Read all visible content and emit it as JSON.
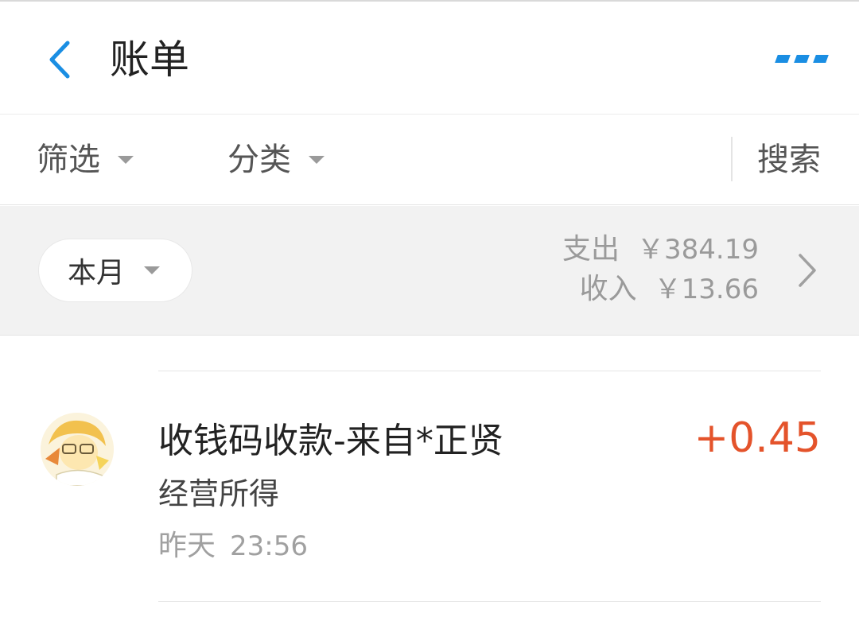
{
  "header": {
    "title": "账单"
  },
  "filters": {
    "filter_label": "筛选",
    "category_label": "分类",
    "search_label": "搜索"
  },
  "summary": {
    "period_label": "本月",
    "expense_label": "支出",
    "expense_amount": "￥384.19",
    "income_label": "收入",
    "income_amount": "￥13.66"
  },
  "transactions": [
    {
      "title": "收钱码收款-来自*正贤",
      "category": "经营所得",
      "day": "昨天",
      "time": "23:56",
      "amount": "+0.45"
    }
  ],
  "colors": {
    "accent": "#1a8ee3",
    "income_amount": "#e4532b",
    "summary_bg": "#f2f2f2"
  }
}
